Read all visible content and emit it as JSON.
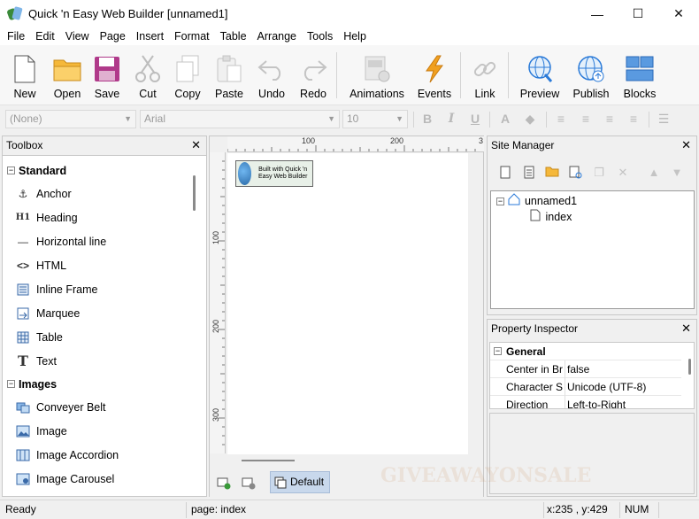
{
  "window": {
    "title": "Quick 'n Easy Web Builder [unnamed1]",
    "minimize": "—",
    "maximize": "☐",
    "close": "✕"
  },
  "menu": [
    "File",
    "Edit",
    "View",
    "Page",
    "Insert",
    "Format",
    "Table",
    "Arrange",
    "Tools",
    "Help"
  ],
  "toolbar": {
    "new": "New",
    "open": "Open",
    "save": "Save",
    "cut": "Cut",
    "copy": "Copy",
    "paste": "Paste",
    "undo": "Undo",
    "redo": "Redo",
    "animations": "Animations",
    "events": "Events",
    "link": "Link",
    "preview": "Preview",
    "publish": "Publish",
    "blocks": "Blocks"
  },
  "formatbar": {
    "style": "(None)",
    "font": "Arial",
    "size": "10",
    "bold": "B",
    "italic": "I",
    "underline": "U"
  },
  "toolbox": {
    "title": "Toolbox",
    "close": "✕",
    "group_standard": "Standard",
    "group_images": "Images",
    "items_standard": [
      "Anchor",
      "Heading",
      "Horizontal line",
      "HTML",
      "Inline Frame",
      "Marquee",
      "Table",
      "Text"
    ],
    "items_images": [
      "Conveyer Belt",
      "Image",
      "Image Accordion",
      "Image Carousel"
    ],
    "heading_glyph": "H1",
    "text_glyph": "T"
  },
  "design": {
    "ruler_top": [
      "100",
      "200",
      "3"
    ],
    "ruler_left": [
      "100",
      "200",
      "300"
    ],
    "banner_text": "Built with Quick 'n Easy Web Builder",
    "default_tab": "Default"
  },
  "site_manager": {
    "title": "Site Manager",
    "close": "✕",
    "root": "unnamed1",
    "page": "index"
  },
  "property_inspector": {
    "title": "Property Inspector",
    "close": "✕",
    "group": "General",
    "rows": [
      {
        "key": "Center in Br",
        "value": "false"
      },
      {
        "key": "Character S",
        "value": "Unicode (UTF-8)"
      },
      {
        "key": "Direction",
        "value": "Left-to-Right"
      }
    ]
  },
  "statusbar": {
    "status": "Ready",
    "page": "page: index",
    "coords": "x:235 , y:429",
    "num": "NUM"
  },
  "watermark": "GIVEAWAYONSALE",
  "colors": {
    "accent_blue": "#2a7ad8",
    "folder_yellow": "#f5b83a",
    "save_purple": "#b03a8a",
    "events_orange": "#f0a020",
    "tab_selected": "#c8d8ec"
  }
}
